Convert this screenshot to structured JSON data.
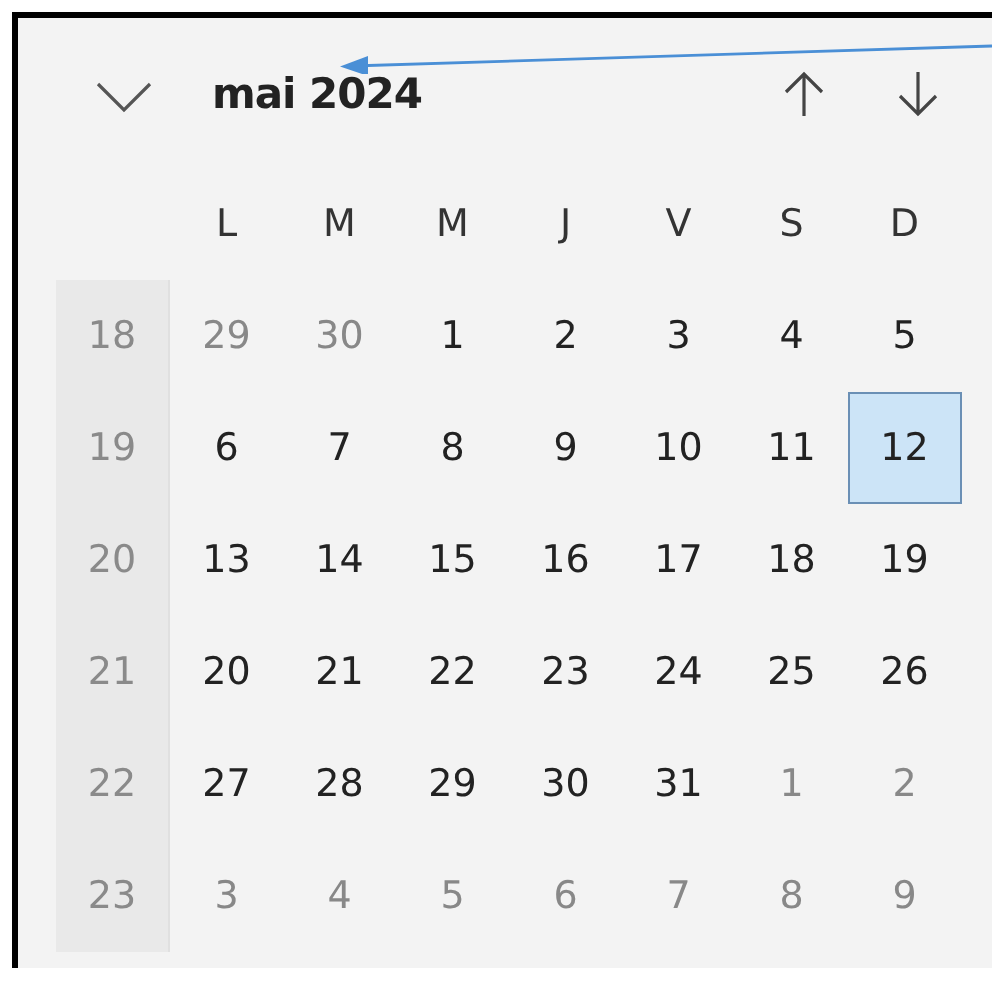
{
  "header": {
    "title": "mai 2024"
  },
  "weekdays": [
    "L",
    "M",
    "M",
    "J",
    "V",
    "S",
    "D"
  ],
  "weeks": [
    {
      "number": "18",
      "days": [
        {
          "label": "29",
          "outside": true,
          "selected": false
        },
        {
          "label": "30",
          "outside": true,
          "selected": false
        },
        {
          "label": "1",
          "outside": false,
          "selected": false
        },
        {
          "label": "2",
          "outside": false,
          "selected": false
        },
        {
          "label": "3",
          "outside": false,
          "selected": false
        },
        {
          "label": "4",
          "outside": false,
          "selected": false
        },
        {
          "label": "5",
          "outside": false,
          "selected": false
        }
      ]
    },
    {
      "number": "19",
      "days": [
        {
          "label": "6",
          "outside": false,
          "selected": false
        },
        {
          "label": "7",
          "outside": false,
          "selected": false
        },
        {
          "label": "8",
          "outside": false,
          "selected": false
        },
        {
          "label": "9",
          "outside": false,
          "selected": false
        },
        {
          "label": "10",
          "outside": false,
          "selected": false
        },
        {
          "label": "11",
          "outside": false,
          "selected": false
        },
        {
          "label": "12",
          "outside": false,
          "selected": true
        }
      ]
    },
    {
      "number": "20",
      "days": [
        {
          "label": "13",
          "outside": false,
          "selected": false
        },
        {
          "label": "14",
          "outside": false,
          "selected": false
        },
        {
          "label": "15",
          "outside": false,
          "selected": false
        },
        {
          "label": "16",
          "outside": false,
          "selected": false
        },
        {
          "label": "17",
          "outside": false,
          "selected": false
        },
        {
          "label": "18",
          "outside": false,
          "selected": false
        },
        {
          "label": "19",
          "outside": false,
          "selected": false
        }
      ]
    },
    {
      "number": "21",
      "days": [
        {
          "label": "20",
          "outside": false,
          "selected": false
        },
        {
          "label": "21",
          "outside": false,
          "selected": false
        },
        {
          "label": "22",
          "outside": false,
          "selected": false
        },
        {
          "label": "23",
          "outside": false,
          "selected": false
        },
        {
          "label": "24",
          "outside": false,
          "selected": false
        },
        {
          "label": "25",
          "outside": false,
          "selected": false
        },
        {
          "label": "26",
          "outside": false,
          "selected": false
        }
      ]
    },
    {
      "number": "22",
      "days": [
        {
          "label": "27",
          "outside": false,
          "selected": false
        },
        {
          "label": "28",
          "outside": false,
          "selected": false
        },
        {
          "label": "29",
          "outside": false,
          "selected": false
        },
        {
          "label": "30",
          "outside": false,
          "selected": false
        },
        {
          "label": "31",
          "outside": false,
          "selected": false
        },
        {
          "label": "1",
          "outside": true,
          "selected": false
        },
        {
          "label": "2",
          "outside": true,
          "selected": false
        }
      ]
    },
    {
      "number": "23",
      "days": [
        {
          "label": "3",
          "outside": true,
          "selected": false
        },
        {
          "label": "4",
          "outside": true,
          "selected": false
        },
        {
          "label": "5",
          "outside": true,
          "selected": false
        },
        {
          "label": "6",
          "outside": true,
          "selected": false
        },
        {
          "label": "7",
          "outside": true,
          "selected": false
        },
        {
          "label": "8",
          "outside": true,
          "selected": false
        },
        {
          "label": "9",
          "outside": true,
          "selected": false
        }
      ]
    }
  ]
}
